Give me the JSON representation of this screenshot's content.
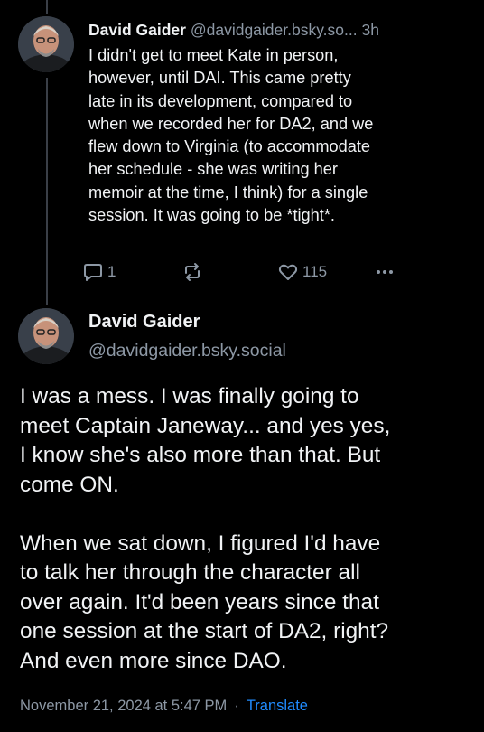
{
  "parent_post": {
    "author_name": "David Gaider",
    "author_handle": "@davidgaider.bsky.so...",
    "time_ago": "3h",
    "text": "I didn't get to meet Kate in person,\nhowever, until DAI. This came pretty\nlate in its development, compared to\nwhen we recorded her for DA2, and we\nflew down to Virginia (to accommodate\nher schedule - she was writing her\nmemoir at the time, I think) for a single\nsession. It was going to be *tight*.",
    "actions": {
      "reply_count": "1",
      "repost_count": "",
      "like_count": "115",
      "reply_icon": "speech-bubble-icon",
      "repost_icon": "repost-arrows-icon",
      "like_icon": "heart-icon",
      "more_icon": "ellipsis-icon"
    }
  },
  "focused_post": {
    "author_name": "David Gaider",
    "author_handle": "@davidgaider.bsky.social",
    "text": "I was a mess. I was finally going to\nmeet Captain Janeway... and yes yes,\nI know she's also more than that. But\ncome ON.\n\nWhen we sat down, I figured I'd have\nto talk her through the character all\nover again. It'd been years since that\none session at the start of DA2, right?\nAnd even more since DAO.",
    "timestamp": "November 21, 2024 at 5:47 PM",
    "separator": "·",
    "translate_label": "Translate"
  },
  "colors": {
    "background": "#000000",
    "text": "#f1f3f5",
    "muted": "#8d98a5",
    "accent": "#208bfe",
    "thread_line": "#3a3f47"
  }
}
